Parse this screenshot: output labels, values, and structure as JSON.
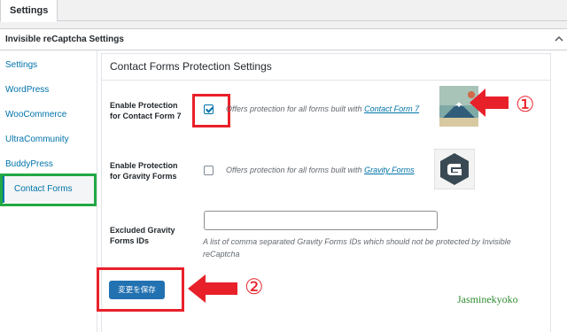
{
  "top_tab": {
    "label": "Settings"
  },
  "panel": {
    "title": "Invisible reCaptcha Settings"
  },
  "sidebar": {
    "items": [
      {
        "label": "Settings"
      },
      {
        "label": "WordPress"
      },
      {
        "label": "WooCommerce"
      },
      {
        "label": "UltraCommunity"
      },
      {
        "label": "BuddyPress"
      },
      {
        "label": "Contact Forms",
        "active": true
      }
    ]
  },
  "content": {
    "title": "Contact Forms Protection Settings",
    "cf7": {
      "label_line1": "Enable Protection",
      "label_line2": "for Contact Form 7",
      "checked": true,
      "desc": "Offers protection for all forms built with",
      "link": "Contact Form 7"
    },
    "gravity": {
      "label_line1": "Enable Protection",
      "label_line2": "for Gravity Forms",
      "checked": false,
      "desc": "Offers protection for all forms built with",
      "link": "Gravity Forms"
    },
    "excluded": {
      "label_line1": "Excluded Gravity",
      "label_line2": "Forms IDs",
      "value": "",
      "help": "A list of comma separated Gravity Forms IDs which should not be protected by Invisible reCaptcha"
    },
    "save_label": "変更を保存"
  },
  "annotations": {
    "marker1": "①",
    "marker2": "②",
    "watermark": "Jasminekyoko"
  },
  "colors": {
    "accent": "#2271b1",
    "annotation_red": "#e8202a",
    "annotation_green": "#22a844"
  }
}
